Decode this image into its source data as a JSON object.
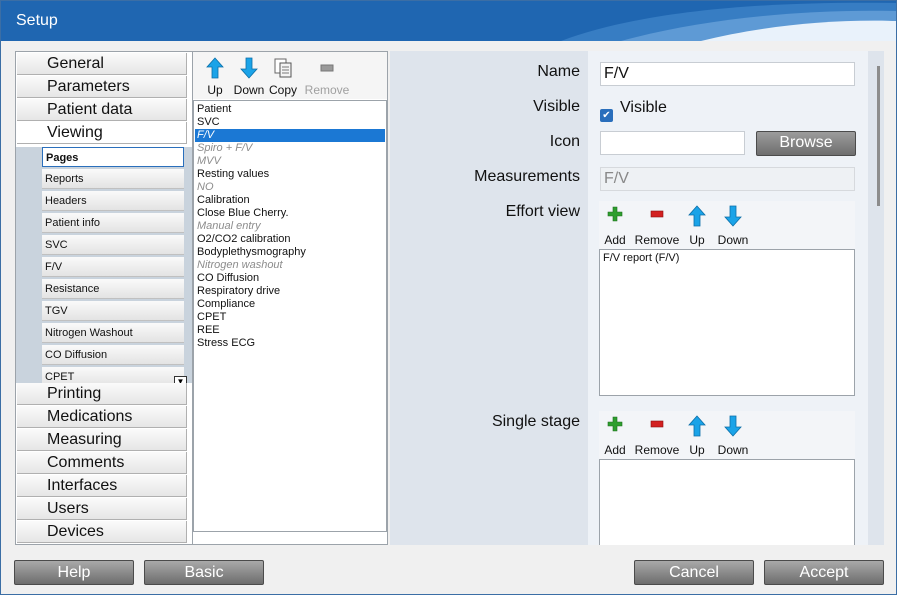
{
  "window": {
    "title": "Setup"
  },
  "nav": {
    "categories_top": [
      "General",
      "Parameters",
      "Patient data",
      "Viewing"
    ],
    "viewing_subitems": [
      "Pages",
      "Reports",
      "Headers",
      "Patient info",
      "SVC",
      "F/V",
      "Resistance",
      "TGV",
      "Nitrogen Washout",
      "CO Diffusion",
      "CPET"
    ],
    "selected_subitem": "Pages",
    "categories_bottom": [
      "Printing",
      "Medications",
      "Measuring",
      "Comments",
      "Interfaces",
      "Users",
      "Devices"
    ]
  },
  "page_toolbar": {
    "up": "Up",
    "down": "Down",
    "copy": "Copy",
    "remove": "Remove"
  },
  "pages": [
    {
      "label": "Patient",
      "state": "normal"
    },
    {
      "label": "SVC",
      "state": "normal"
    },
    {
      "label": "F/V",
      "state": "selected"
    },
    {
      "label": "Spiro + F/V",
      "state": "disabled"
    },
    {
      "label": "MVV",
      "state": "disabled"
    },
    {
      "label": "Resting values",
      "state": "normal"
    },
    {
      "label": "NO",
      "state": "disabled"
    },
    {
      "label": "Calibration",
      "state": "normal"
    },
    {
      "label": "Close Blue Cherry.",
      "state": "normal"
    },
    {
      "label": "Manual entry",
      "state": "disabled"
    },
    {
      "label": "O2/CO2 calibration",
      "state": "normal"
    },
    {
      "label": "Bodyplethysmography",
      "state": "normal"
    },
    {
      "label": "Nitrogen washout",
      "state": "disabled"
    },
    {
      "label": "CO Diffusion",
      "state": "normal"
    },
    {
      "label": "Respiratory drive",
      "state": "normal"
    },
    {
      "label": "Compliance",
      "state": "normal"
    },
    {
      "label": "CPET",
      "state": "normal"
    },
    {
      "label": "REE",
      "state": "normal"
    },
    {
      "label": "Stress ECG",
      "state": "normal"
    }
  ],
  "detail": {
    "name_label": "Name",
    "name_value": "F/V",
    "visible_label": "Visible",
    "visible_checkbox_label": "Visible",
    "visible_checked": true,
    "icon_label": "Icon",
    "icon_value": "",
    "browse_label": "Browse",
    "measurements_label": "Measurements",
    "measurements_value": "F/V",
    "effort_view_label": "Effort view",
    "effort_items": [
      "F/V report (F/V)"
    ],
    "single_stage_label": "Single stage",
    "single_stage_items": [],
    "list_toolbar": {
      "add": "Add",
      "remove": "Remove",
      "up": "Up",
      "down": "Down"
    }
  },
  "footer": {
    "help": "Help",
    "basic": "Basic",
    "cancel": "Cancel",
    "accept": "Accept"
  },
  "colors": {
    "titlebar": "#1f66b1",
    "selection": "#1b78d4",
    "arrow_icon": "#1aa3e8",
    "add_icon": "#2e9e2e",
    "remove_icon": "#d22020"
  }
}
